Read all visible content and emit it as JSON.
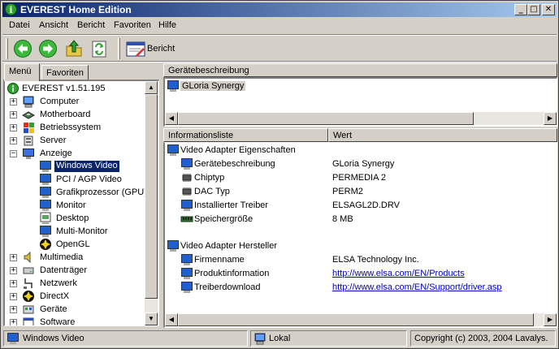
{
  "window": {
    "title": "EVEREST Home Edition"
  },
  "title_buttons": {
    "minimize": "_",
    "maximize": "□",
    "close": "✕"
  },
  "menu": [
    "Datei",
    "Ansicht",
    "Bericht",
    "Favoriten",
    "Hilfe"
  ],
  "toolbar": {
    "report_label": "Bericht"
  },
  "left_tabs": [
    "Menü",
    "Favoriten"
  ],
  "tree": {
    "root": "EVEREST v1.51.195",
    "items": [
      {
        "label": "Computer",
        "icon": "computer-icon",
        "expanded": false
      },
      {
        "label": "Motherboard",
        "icon": "motherboard-icon",
        "expanded": false
      },
      {
        "label": "Betriebssystem",
        "icon": "windows-flag-icon",
        "expanded": false
      },
      {
        "label": "Server",
        "icon": "server-icon",
        "expanded": false
      },
      {
        "label": "Anzeige",
        "icon": "display-icon",
        "expanded": true
      }
    ],
    "display_children": [
      {
        "label": "Windows Video",
        "icon": "monitor-icon",
        "selected": true
      },
      {
        "label": "PCI / AGP Video",
        "icon": "monitor-icon"
      },
      {
        "label": "Grafikprozessor (GPU)",
        "icon": "monitor-icon"
      },
      {
        "label": "Monitor",
        "icon": "monitor-icon"
      },
      {
        "label": "Desktop",
        "icon": "desktop-icon"
      },
      {
        "label": "Multi-Monitor",
        "icon": "monitor-icon"
      },
      {
        "label": "OpenGL",
        "icon": "opengl-icon"
      }
    ],
    "items_after": [
      {
        "label": "Multimedia",
        "icon": "speaker-icon"
      },
      {
        "label": "Datenträger",
        "icon": "drive-icon"
      },
      {
        "label": "Netzwerk",
        "icon": "network-icon"
      },
      {
        "label": "DirectX",
        "icon": "directx-icon"
      },
      {
        "label": "Geräte",
        "icon": "devices-icon"
      },
      {
        "label": "Software",
        "icon": "software-icon"
      }
    ]
  },
  "device_panel": {
    "header": "Gerätebeschreibung",
    "items": [
      "GLoria Synergy"
    ]
  },
  "info_panel": {
    "col_field": "Informationsliste",
    "col_value": "Wert",
    "groups": [
      {
        "title": "Video Adapter Eigenschaften",
        "rows": [
          {
            "field": "Gerätebeschreibung",
            "value": "GLoria Synergy",
            "icon": "monitor-icon"
          },
          {
            "field": "Chiptyp",
            "value": "PERMEDIA 2",
            "icon": "chip-icon"
          },
          {
            "field": "DAC Typ",
            "value": "PERM2",
            "icon": "chip-icon"
          },
          {
            "field": "Installierter Treiber",
            "value": "ELSAGL2D.DRV",
            "icon": "monitor-icon"
          },
          {
            "field": "Speichergröße",
            "value": "8 MB",
            "icon": "memory-icon"
          }
        ]
      },
      {
        "title": "Video Adapter Hersteller",
        "rows": [
          {
            "field": "Firmenname",
            "value": "ELSA Technology Inc.",
            "icon": "monitor-icon",
            "link": false
          },
          {
            "field": "Produktinformation",
            "value": "http://www.elsa.com/EN/Products",
            "icon": "monitor-icon",
            "link": true
          },
          {
            "field": "Treiberdownload",
            "value": "http://www.elsa.com/EN/Support/driver.asp",
            "icon": "monitor-icon",
            "link": true
          }
        ]
      }
    ]
  },
  "status": {
    "left": "Windows Video",
    "middle": "Lokal",
    "right": "Copyright (c) 2003, 2004 Lavalys."
  },
  "colors": {
    "titlebar_start": "#0a246a",
    "titlebar_end": "#a6caf0",
    "selection": "#0a246a",
    "link": "#0000c0"
  }
}
